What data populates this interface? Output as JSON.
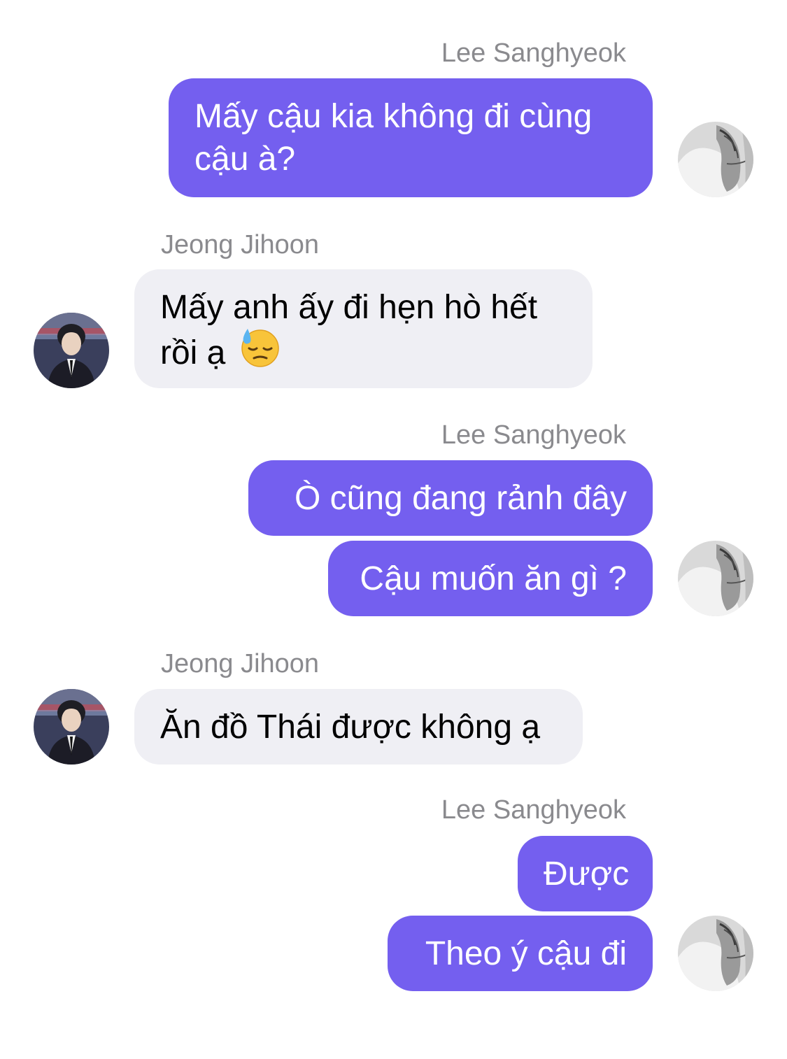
{
  "chat": {
    "sender_a": "Lee Sanghyeok",
    "sender_b": "Jeong Jihoon",
    "messages": [
      {
        "lines": [
          "Mấy cậu kia không đi cùng",
          "cậu à?"
        ]
      },
      {
        "lines": [
          "Mấy anh ấy đi hẹn hò hết",
          "rồi ạ"
        ],
        "emoji": "downcast-face-with-sweat-emoji"
      },
      {
        "text": "Ò cũng đang rảnh đây"
      },
      {
        "text": "Cậu muốn ăn gì ?"
      },
      {
        "text": "Ăn đồ Thái được không ạ"
      },
      {
        "text": "Được"
      },
      {
        "text": "Theo ý cậu đi"
      }
    ]
  },
  "colors": {
    "outgoing_bubble": "#745fef",
    "incoming_bubble": "#efeff4",
    "sender_name": "#8a8a8e",
    "outgoing_text": "#ffffff",
    "incoming_text": "#000000"
  }
}
